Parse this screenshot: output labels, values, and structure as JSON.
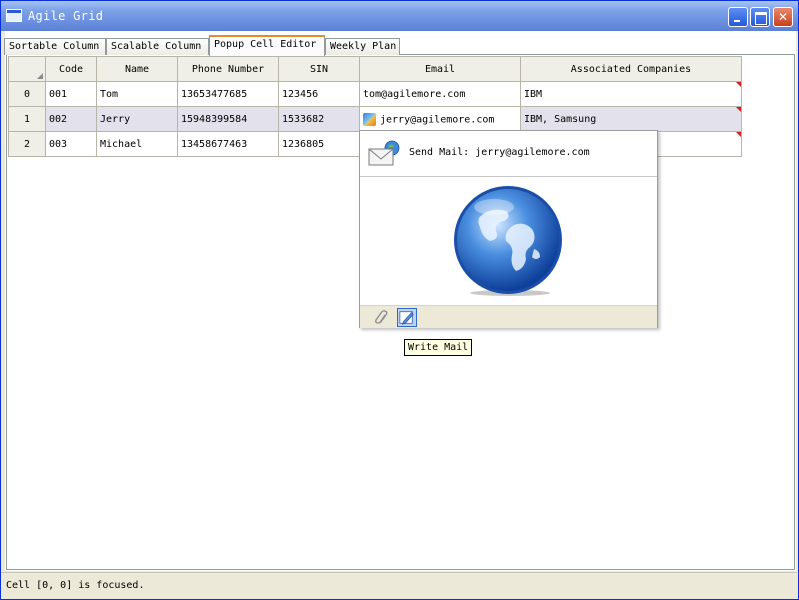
{
  "window": {
    "title": "Agile Grid"
  },
  "tabs": [
    {
      "label": "Sortable Column"
    },
    {
      "label": "Scalable Column"
    },
    {
      "label": "Popup Cell Editor"
    },
    {
      "label": "Weekly Plan"
    }
  ],
  "grid": {
    "columns": [
      "Code",
      "Name",
      "Phone Number",
      "SIN",
      "Email",
      "Associated Companies"
    ],
    "rows": [
      {
        "index": "0",
        "code": "001",
        "name": "Tom",
        "phone": "13653477685",
        "sin": "123456",
        "email": "tom@agilemore.com",
        "companies": "IBM"
      },
      {
        "index": "1",
        "code": "002",
        "name": "Jerry",
        "phone": "15948399584",
        "sin": "1533682",
        "email": "jerry@agilemore.com",
        "companies": "IBM, Samsung"
      },
      {
        "index": "2",
        "code": "003",
        "name": "Michael",
        "phone": "13458677463",
        "sin": "1236805",
        "email": "",
        "companies": ""
      }
    ]
  },
  "popup": {
    "title": "Send Mail: jerry@agilemore.com",
    "tools": [
      {
        "icon": "attachment-icon"
      },
      {
        "icon": "write-mail-icon"
      }
    ]
  },
  "tooltip": {
    "text": "Write Mail"
  },
  "status": {
    "text": "Cell [0, 0] is focused."
  }
}
